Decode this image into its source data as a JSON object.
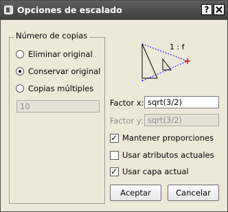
{
  "window": {
    "title": "Opciones de escalado",
    "help_label": "?",
    "close_label": "X"
  },
  "copies_group": {
    "title": "Número de copias",
    "options": [
      {
        "label": "Eliminar original",
        "checked": false
      },
      {
        "label": "Conservar original",
        "checked": true
      },
      {
        "label": "Copias múltiples",
        "checked": false
      }
    ],
    "count_value": "10"
  },
  "diagram": {
    "ratio_label": "1 : f",
    "marker_color": "#ff0000",
    "line_color": "#0000ff"
  },
  "factor_x": {
    "label": "Factor x:",
    "value": "sqrt(3/2)"
  },
  "factor_y": {
    "label": "Factor y:",
    "value": "sqrt(3/2)"
  },
  "options": [
    {
      "label": "Mantener proporciones",
      "checked": true
    },
    {
      "label": "Usar atributos actuales",
      "checked": false
    },
    {
      "label": "Usar capa actual",
      "checked": true
    }
  ],
  "buttons": {
    "accept": "Aceptar",
    "cancel": "Cancelar"
  }
}
